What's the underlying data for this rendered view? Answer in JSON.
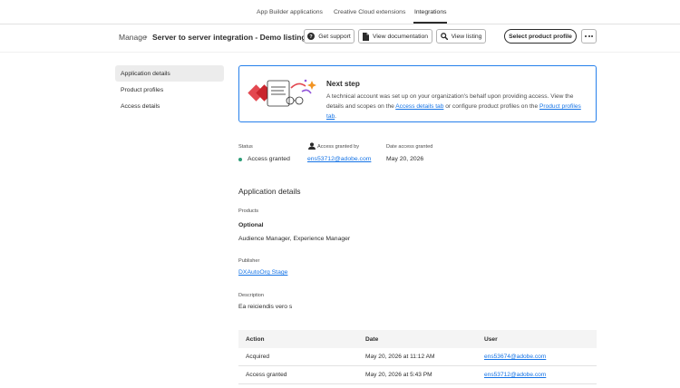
{
  "top_tabs": [
    {
      "label": "App Builder applications"
    },
    {
      "label": "Creative Cloud extensions"
    },
    {
      "label": "Integrations",
      "active": true
    }
  ],
  "breadcrumb": {
    "root": "Manage",
    "separator": "›",
    "title": "Server to server integration - Demo listing"
  },
  "header_buttons": {
    "support": "Get support",
    "documentation": "View documentation",
    "listing": "View listing",
    "profile": "Select product profile"
  },
  "sidenav": [
    {
      "label": "Application details",
      "selected": true
    },
    {
      "label": "Product profiles"
    },
    {
      "label": "Access details"
    }
  ],
  "next_step": {
    "title": "Next step",
    "text_1": "A technical account was set up on your organization's behalf upon providing access. View the details and scopes on the ",
    "link_1": "Access details tab",
    "text_2": " or configure product profiles on the ",
    "link_2": "Product profiles tab",
    "text_3": "."
  },
  "status": {
    "status_label": "Status",
    "status_value": "Access granted",
    "granted_by_label": "Access granted by",
    "granted_by_value": "ens53712@adobe.com",
    "date_label": "Date access granted",
    "date_value": "May 20, 2026"
  },
  "app_details": {
    "title": "Application details",
    "products_label": "Products",
    "products_heading": "Optional",
    "products_value": "Audience Manager, Experience Manager",
    "publisher_label": "Publisher",
    "publisher_value": "DXAutoOrg Stage",
    "description_label": "Description",
    "description_value": "Ea reiciendis vero s"
  },
  "history_table": {
    "columns": [
      "Action",
      "Date",
      "User"
    ],
    "rows": [
      {
        "action": "Acquired",
        "date": "May 20, 2026 at 11:12 AM",
        "user": "ens53674@adobe.com"
      },
      {
        "action": "Access granted",
        "date": "May 20, 2026 at 5:43 PM",
        "user": "ens53712@adobe.com"
      }
    ]
  },
  "colors": {
    "accent": "#1473e6",
    "card_border": "#2680eb",
    "status_green": "#2d9d78"
  },
  "icons": [
    "help-icon",
    "document-icon",
    "search-icon",
    "more-icon",
    "user-icon"
  ]
}
